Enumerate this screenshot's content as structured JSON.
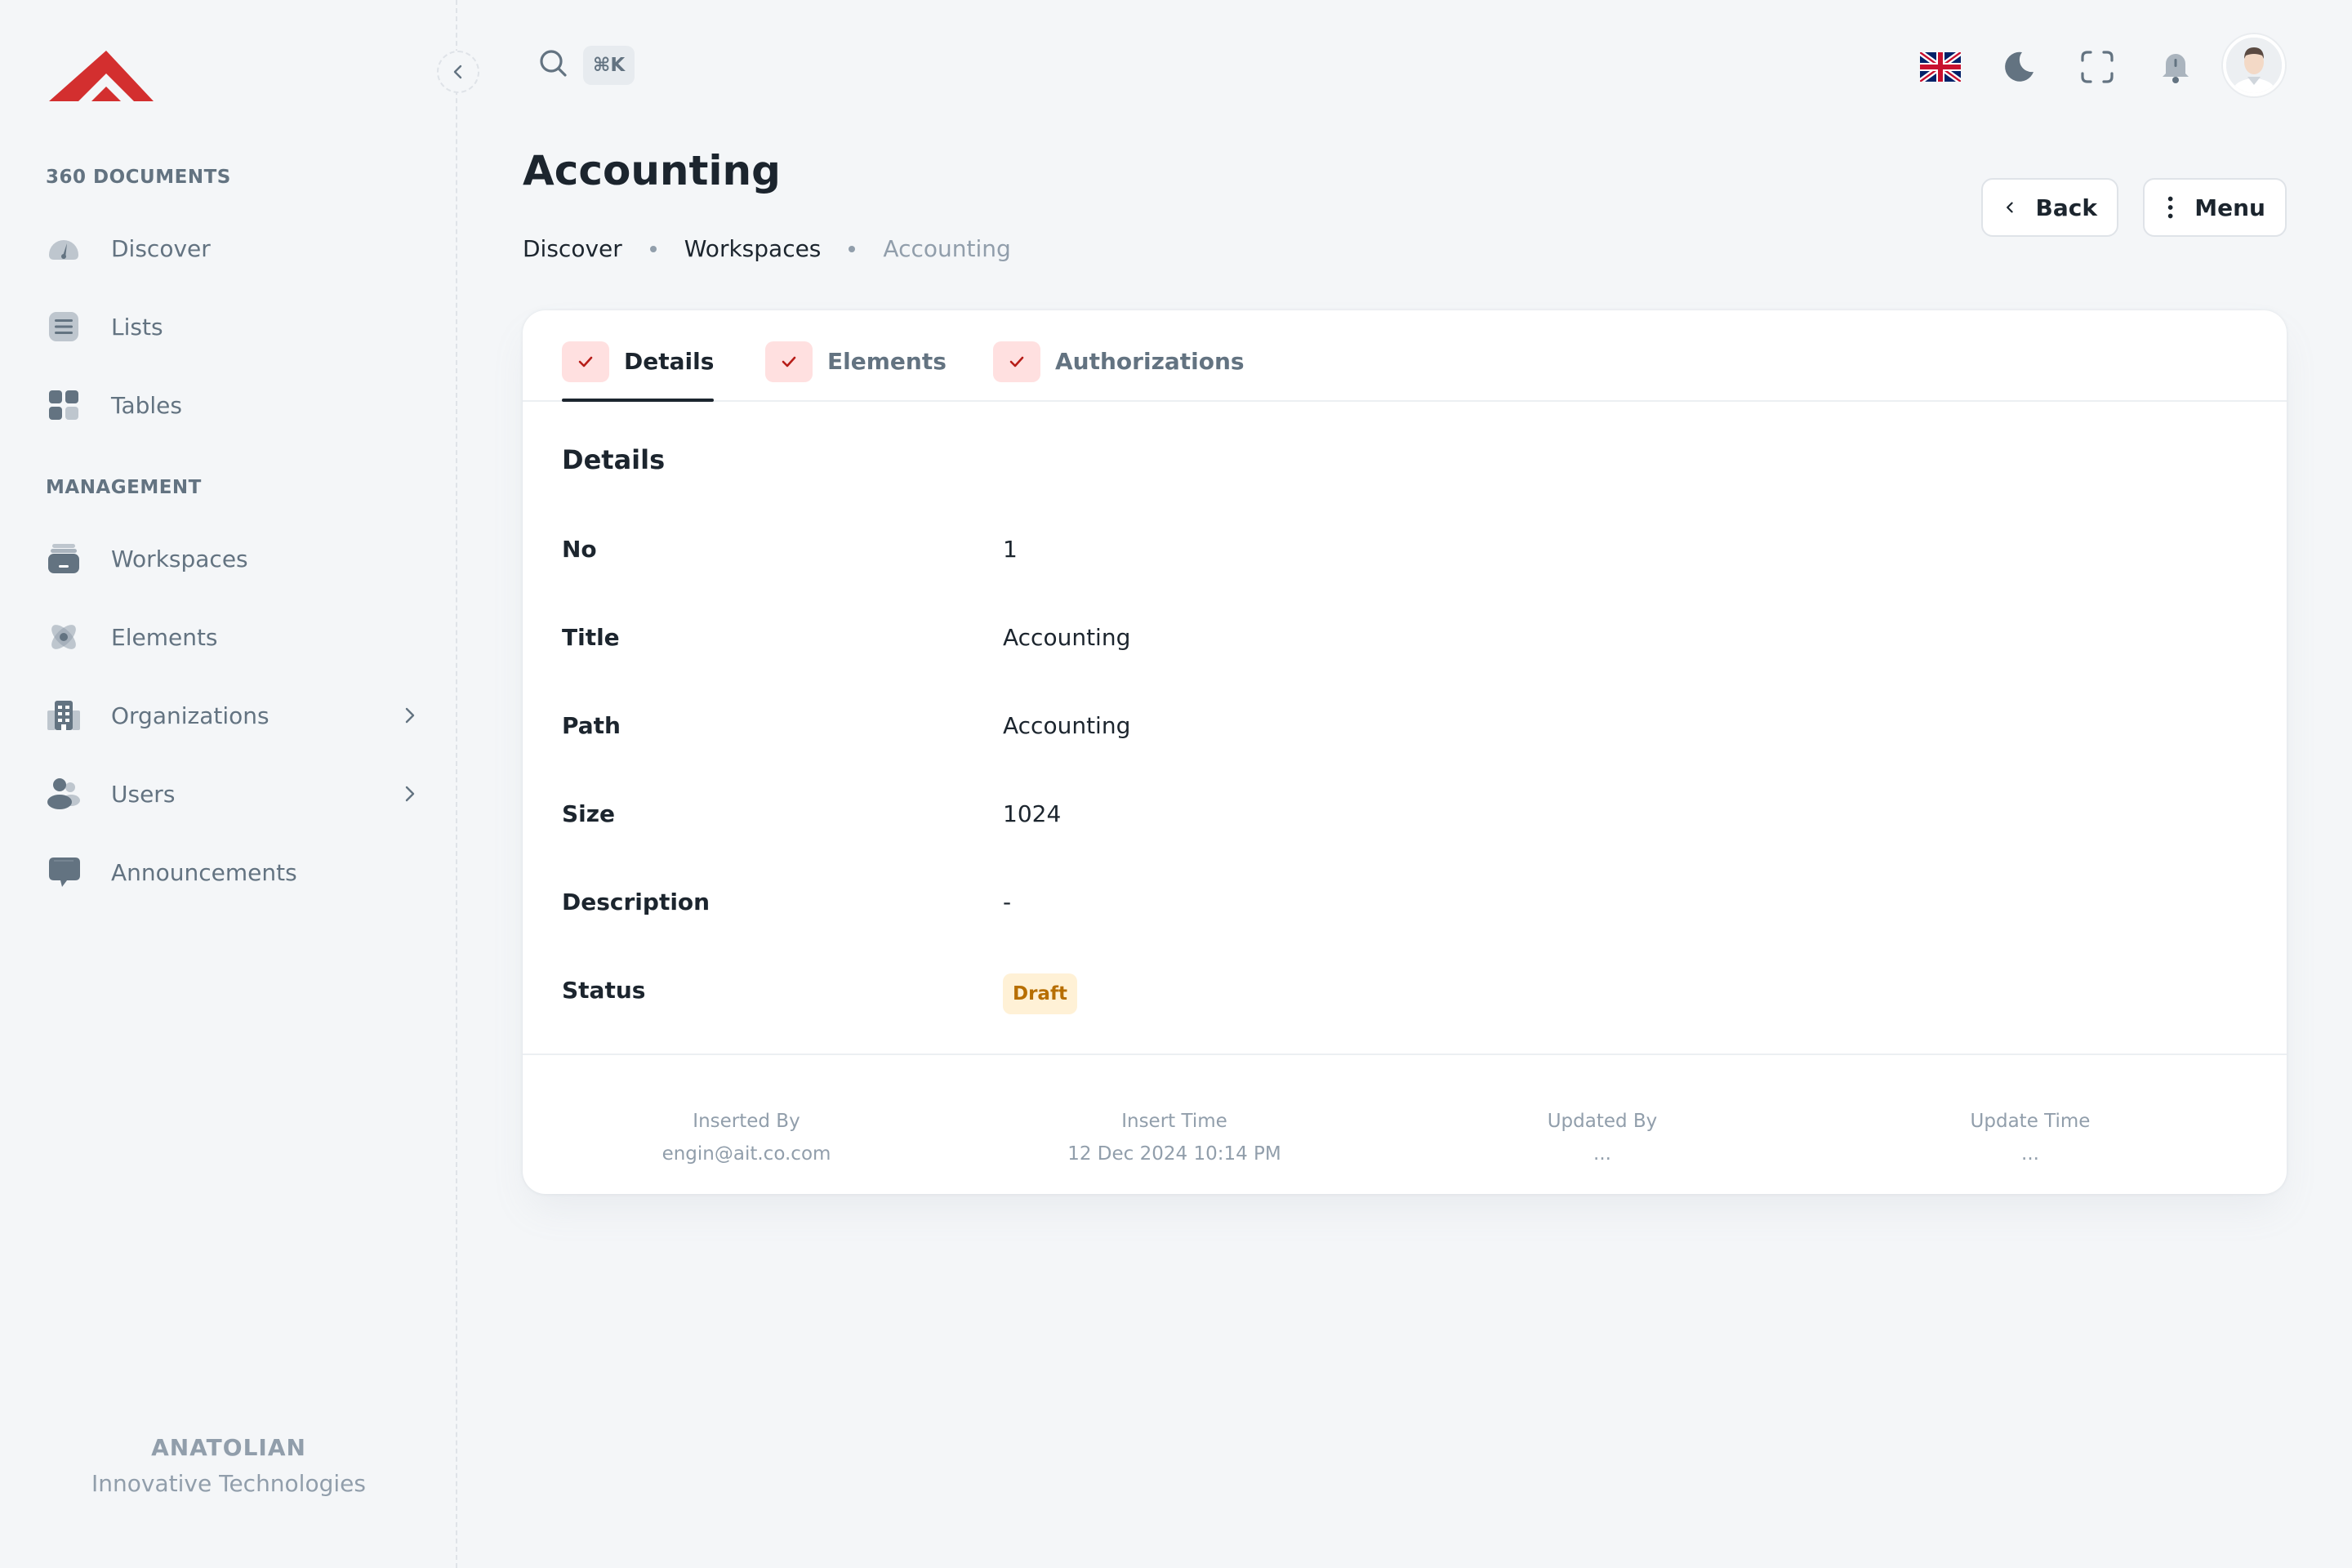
{
  "sidebar": {
    "sections": [
      {
        "title": "360 DOCUMENTS"
      },
      {
        "title": "MANAGEMENT"
      }
    ],
    "items": [
      {
        "label": "Discover",
        "icon": "dashboard-icon"
      },
      {
        "label": "Lists",
        "icon": "list-icon"
      },
      {
        "label": "Tables",
        "icon": "grid-icon"
      },
      {
        "label": "Workspaces",
        "icon": "archive-icon"
      },
      {
        "label": "Elements",
        "icon": "atom-icon"
      },
      {
        "label": "Organizations",
        "icon": "building-icon"
      },
      {
        "label": "Users",
        "icon": "users-icon"
      },
      {
        "label": "Announcements",
        "icon": "chat-icon"
      }
    ],
    "brand": {
      "name": "ANATOLIAN",
      "tagline": "Innovative Technologies"
    }
  },
  "header": {
    "shortcut": "⌘K"
  },
  "page": {
    "title": "Accounting",
    "breadcrumb": [
      "Discover",
      "Workspaces",
      "Accounting"
    ],
    "back_label": "Back",
    "menu_label": "Menu"
  },
  "tabs": [
    {
      "label": "Details",
      "active": true
    },
    {
      "label": "Elements",
      "active": false
    },
    {
      "label": "Authorizations",
      "active": false
    }
  ],
  "details": {
    "heading": "Details",
    "rows": [
      {
        "label": "No",
        "value": "1"
      },
      {
        "label": "Title",
        "value": "Accounting"
      },
      {
        "label": "Path",
        "value": "Accounting"
      },
      {
        "label": "Size",
        "value": "1024"
      },
      {
        "label": "Description",
        "value": "-"
      },
      {
        "label": "Status",
        "value": "Draft"
      }
    ]
  },
  "meta": [
    {
      "label": "Inserted By",
      "value": "engin@ait.co.com"
    },
    {
      "label": "Insert Time",
      "value": "12 Dec 2024 10:14 PM"
    },
    {
      "label": "Updated By",
      "value": "..."
    },
    {
      "label": "Update Time",
      "value": "..."
    }
  ],
  "colors": {
    "accent": "#d32f2f",
    "status_draft_bg": "#fff1d6",
    "status_draft_text": "#b76e00",
    "tab_check_bg": "#ffe0e0"
  }
}
